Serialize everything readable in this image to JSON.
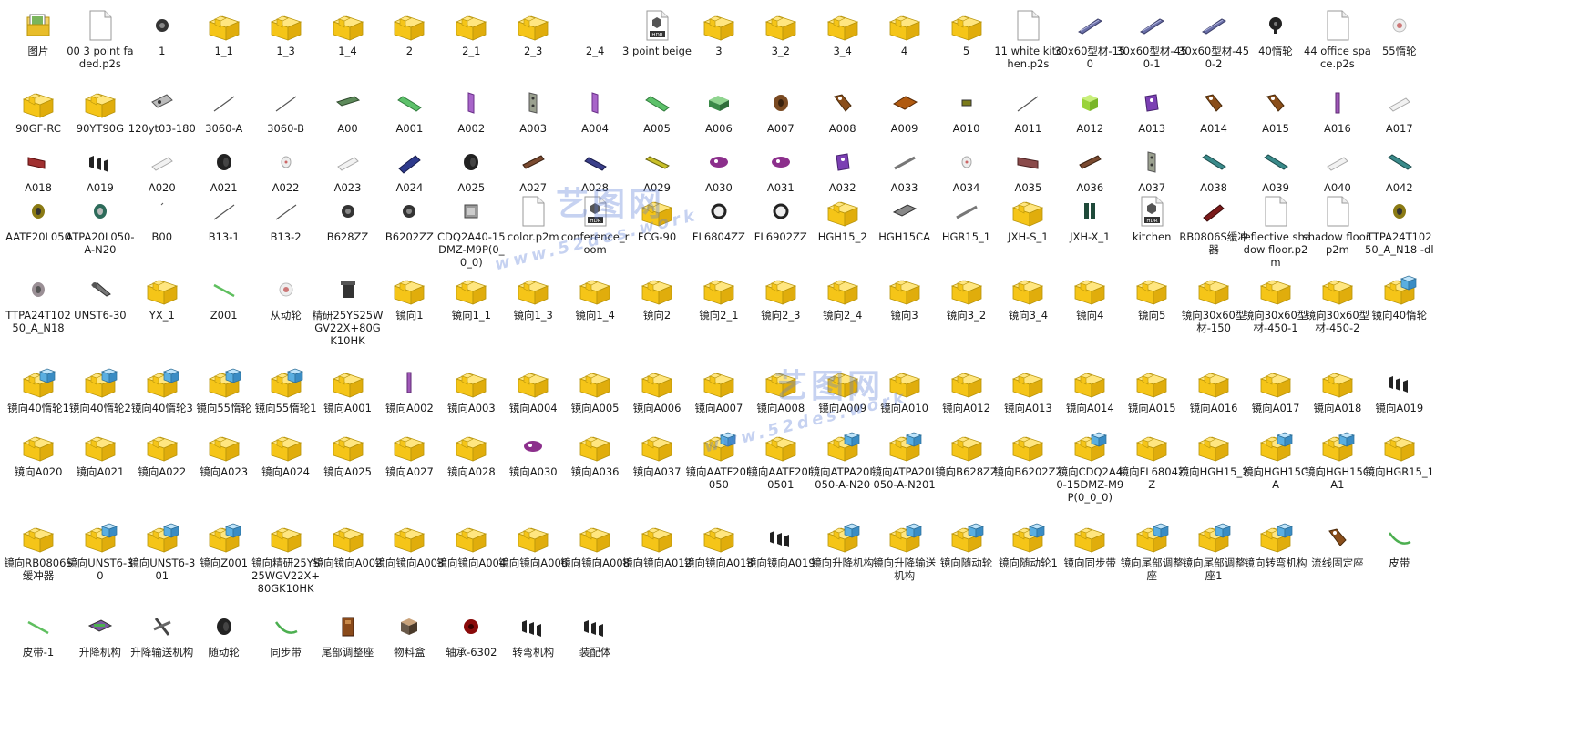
{
  "rows": [
    [
      {
        "label": "图片",
        "icon": "folder-pictures-icon"
      },
      {
        "label": "00 3 point faded.p2s",
        "icon": "document-file-icon"
      },
      {
        "label": "1",
        "icon": "bearing-part-icon"
      },
      {
        "label": "1_1",
        "icon": "assembly-icon"
      },
      {
        "label": "1_3",
        "icon": "assembly-icon"
      },
      {
        "label": "1_4",
        "icon": "assembly-icon"
      },
      {
        "label": "2",
        "icon": "assembly-icon"
      },
      {
        "label": "2_1",
        "icon": "assembly-icon"
      },
      {
        "label": "2_3",
        "icon": "assembly-icon"
      },
      {
        "label": "2_4",
        "icon": "blank-icon"
      },
      {
        "label": "3 point beige",
        "icon": "hdr-file-icon"
      },
      {
        "label": "3",
        "icon": "assembly-icon"
      },
      {
        "label": "3_2",
        "icon": "assembly-icon"
      },
      {
        "label": "3_4",
        "icon": "assembly-icon"
      },
      {
        "label": "4",
        "icon": "assembly-icon"
      },
      {
        "label": "5",
        "icon": "assembly-icon"
      },
      {
        "label": "11 white kitchen.p2s",
        "icon": "document-file-icon"
      },
      {
        "label": "30x60型材-150",
        "icon": "profile-bar-part-icon"
      },
      {
        "label": "30x60型材-450-1",
        "icon": "profile-bar-part-icon"
      },
      {
        "label": "30x60型材-450-2",
        "icon": "profile-bar-part-icon"
      },
      {
        "label": "40惰轮",
        "icon": "idler-wheel-part-icon"
      },
      {
        "label": "44 office space.p2s",
        "icon": "document-file-icon"
      },
      {
        "label": "55惰轮",
        "icon": "pulley-part-icon"
      }
    ],
    [
      {
        "label": "90GF-RC",
        "icon": "assembly-icon"
      },
      {
        "label": "90YT90G",
        "icon": "assembly-icon"
      },
      {
        "label": "120yt03-180",
        "icon": "motor-part-icon"
      },
      {
        "label": "3060-A",
        "icon": "thin-rod-part-icon"
      },
      {
        "label": "3060-B",
        "icon": "thin-rod-part-icon"
      },
      {
        "label": "A00",
        "icon": "plate-part-icon"
      },
      {
        "label": "A001",
        "icon": "green-bar-part-icon"
      },
      {
        "label": "A002",
        "icon": "purple-plate-part-icon"
      },
      {
        "label": "A003",
        "icon": "grey-plate-part-icon"
      },
      {
        "label": "A004",
        "icon": "purple-plate-part-icon"
      },
      {
        "label": "A005",
        "icon": "green-bar-part-icon"
      },
      {
        "label": "A006",
        "icon": "green-block-part-icon"
      },
      {
        "label": "A007",
        "icon": "brown-round-part-icon"
      },
      {
        "label": "A008",
        "icon": "brown-bracket-part-icon"
      },
      {
        "label": "A009",
        "icon": "orange-block-part-icon"
      },
      {
        "label": "A010",
        "icon": "small-block-part-icon"
      },
      {
        "label": "A011",
        "icon": "thin-rod-part-icon"
      },
      {
        "label": "A012",
        "icon": "lime-cube-part-icon"
      },
      {
        "label": "A013",
        "icon": "purple-block-part-icon"
      },
      {
        "label": "A014",
        "icon": "brown-bracket-part-icon"
      },
      {
        "label": "A015",
        "icon": "brown-bracket-part-icon"
      },
      {
        "label": "A016",
        "icon": "purple-bar-part-icon"
      },
      {
        "label": "A017",
        "icon": "white-cylinder-part-icon"
      }
    ],
    [
      {
        "label": "A018",
        "icon": "red-block-part-icon"
      },
      {
        "label": "A019",
        "icon": "black-chain-part-icon"
      },
      {
        "label": "A020",
        "icon": "white-cylinder-part-icon"
      },
      {
        "label": "A021",
        "icon": "black-round-part-icon"
      },
      {
        "label": "A022",
        "icon": "white-small-part-icon"
      },
      {
        "label": "A023",
        "icon": "white-cylinder-part-icon"
      },
      {
        "label": "A024",
        "icon": "blue-cylinder-part-icon"
      },
      {
        "label": "A025",
        "icon": "black-round-part-icon"
      },
      {
        "label": "A027",
        "icon": "brown-bar-part-icon"
      },
      {
        "label": "A028",
        "icon": "navy-bar-part-icon"
      },
      {
        "label": "A029",
        "icon": "yellow-bar-part-icon"
      },
      {
        "label": "A030",
        "icon": "purple-disc-part-icon"
      },
      {
        "label": "A031",
        "icon": "purple-disc-part-icon"
      },
      {
        "label": "A032",
        "icon": "purple-block-part-icon"
      },
      {
        "label": "A033",
        "icon": "grey-bar-part-icon"
      },
      {
        "label": "A034",
        "icon": "white-small-part-icon"
      },
      {
        "label": "A035",
        "icon": "brown-plate-part-icon"
      },
      {
        "label": "A036",
        "icon": "brown-bar-part-icon"
      },
      {
        "label": "A037",
        "icon": "grey-plate-part-icon"
      },
      {
        "label": "A038",
        "icon": "teal-rail-part-icon"
      },
      {
        "label": "A039",
        "icon": "teal-rail-part-icon"
      },
      {
        "label": "A040",
        "icon": "white-cylinder-part-icon"
      },
      {
        "label": "A042",
        "icon": "teal-rail-part-icon"
      }
    ],
    [
      {
        "label": "AATF20L050",
        "icon": "gold-pulley-part-icon"
      },
      {
        "label": "ATPA20L050-A-N20",
        "icon": "teal-pulley-part-icon"
      },
      {
        "label": "B00",
        "icon": "dot-part-icon"
      },
      {
        "label": "B13-1",
        "icon": "thin-rod-part-icon"
      },
      {
        "label": "B13-2",
        "icon": "thin-rod-part-icon"
      },
      {
        "label": "B628ZZ",
        "icon": "bearing-part-icon"
      },
      {
        "label": "B6202ZZ",
        "icon": "bearing-part-icon"
      },
      {
        "label": "CDQ2A40-15DMZ-M9P(0_0_0)",
        "icon": "cylinder-part-icon"
      },
      {
        "label": "color.p2m",
        "icon": "document-file-icon"
      },
      {
        "label": "conference_room",
        "icon": "hdr-file-icon"
      },
      {
        "label": "FCG-90",
        "icon": "assembly-icon"
      },
      {
        "label": "FL6804ZZ",
        "icon": "ring-bearing-part-icon"
      },
      {
        "label": "FL6902ZZ",
        "icon": "ring-bearing-part-icon"
      },
      {
        "label": "HGH15_2",
        "icon": "assembly-icon"
      },
      {
        "label": "HGH15CA",
        "icon": "grey-block-part-icon"
      },
      {
        "label": "HGR15_1",
        "icon": "grey-bar-part-icon"
      },
      {
        "label": "JXH-S_1",
        "icon": "assembly-icon"
      },
      {
        "label": "JXH-X_1",
        "icon": "dark-bracket-part-icon"
      },
      {
        "label": "kitchen",
        "icon": "hdr-file-icon"
      },
      {
        "label": "RB0806S缓冲器",
        "icon": "red-buffer-part-icon"
      },
      {
        "label": "reflective shadow floor.p2m",
        "icon": "document-file-icon"
      },
      {
        "label": "shadow floor.p2m",
        "icon": "document-file-icon"
      },
      {
        "label": "TTPA24T10250_A_N18 -dl",
        "icon": "gold-pulley-part-icon"
      }
    ],
    [
      {
        "label": "TTPA24T10250_A_N18",
        "icon": "grey-pulley-part-icon"
      },
      {
        "label": "UNST6-30",
        "icon": "bolt-part-icon"
      },
      {
        "label": "YX_1",
        "icon": "assembly-icon"
      },
      {
        "label": "Z001",
        "icon": "green-rod-part-icon"
      },
      {
        "label": "从动轮",
        "icon": "pulley-part-icon"
      },
      {
        "label": "精研25YS25WGV22X+80GK10HK",
        "icon": "gear-motor-part-icon"
      },
      {
        "label": "镜向1",
        "icon": "assembly-icon"
      },
      {
        "label": "镜向1_1",
        "icon": "assembly-icon"
      },
      {
        "label": "镜向1_3",
        "icon": "assembly-icon"
      },
      {
        "label": "镜向1_4",
        "icon": "assembly-icon"
      },
      {
        "label": "镜向2",
        "icon": "assembly-icon"
      },
      {
        "label": "镜向2_1",
        "icon": "assembly-icon"
      },
      {
        "label": "镜向2_3",
        "icon": "assembly-icon"
      },
      {
        "label": "镜向2_4",
        "icon": "assembly-icon"
      },
      {
        "label": "镜向3",
        "icon": "assembly-icon"
      },
      {
        "label": "镜向3_2",
        "icon": "assembly-icon"
      },
      {
        "label": "镜向3_4",
        "icon": "assembly-icon"
      },
      {
        "label": "镜向4",
        "icon": "assembly-icon"
      },
      {
        "label": "镜向5",
        "icon": "assembly-icon"
      },
      {
        "label": "镜向30x60型材-150",
        "icon": "assembly-icon"
      },
      {
        "label": "镜向30x60型材-450-1",
        "icon": "assembly-icon"
      },
      {
        "label": "镜向30x60型材-450-2",
        "icon": "assembly-icon"
      },
      {
        "label": "镜向40惰轮",
        "icon": "mirror-assembly-icon"
      }
    ],
    [
      {
        "label": "镜向40惰轮1",
        "icon": "mirror-assembly-icon"
      },
      {
        "label": "镜向40惰轮2",
        "icon": "mirror-assembly-icon"
      },
      {
        "label": "镜向40惰轮3",
        "icon": "mirror-assembly-icon"
      },
      {
        "label": "镜向55惰轮",
        "icon": "mirror-assembly-icon"
      },
      {
        "label": "镜向55惰轮1",
        "icon": "mirror-assembly-icon"
      },
      {
        "label": "镜向A001",
        "icon": "assembly-icon"
      },
      {
        "label": "镜向A002",
        "icon": "purple-bar-part-icon"
      },
      {
        "label": "镜向A003",
        "icon": "assembly-icon"
      },
      {
        "label": "镜向A004",
        "icon": "assembly-icon"
      },
      {
        "label": "镜向A005",
        "icon": "assembly-icon"
      },
      {
        "label": "镜向A006",
        "icon": "assembly-icon"
      },
      {
        "label": "镜向A007",
        "icon": "assembly-icon"
      },
      {
        "label": "镜向A008",
        "icon": "assembly-icon"
      },
      {
        "label": "镜向A009",
        "icon": "assembly-icon"
      },
      {
        "label": "镜向A010",
        "icon": "assembly-icon"
      },
      {
        "label": "镜向A012",
        "icon": "assembly-icon"
      },
      {
        "label": "镜向A013",
        "icon": "assembly-icon"
      },
      {
        "label": "镜向A014",
        "icon": "assembly-icon"
      },
      {
        "label": "镜向A015",
        "icon": "assembly-icon"
      },
      {
        "label": "镜向A016",
        "icon": "assembly-icon"
      },
      {
        "label": "镜向A017",
        "icon": "assembly-icon"
      },
      {
        "label": "镜向A018",
        "icon": "assembly-icon"
      },
      {
        "label": "镜向A019",
        "icon": "black-chain-part-icon"
      }
    ],
    [
      {
        "label": "镜向A020",
        "icon": "assembly-icon"
      },
      {
        "label": "镜向A021",
        "icon": "assembly-icon"
      },
      {
        "label": "镜向A022",
        "icon": "assembly-icon"
      },
      {
        "label": "镜向A023",
        "icon": "assembly-icon"
      },
      {
        "label": "镜向A024",
        "icon": "assembly-icon"
      },
      {
        "label": "镜向A025",
        "icon": "assembly-icon"
      },
      {
        "label": "镜向A027",
        "icon": "assembly-icon"
      },
      {
        "label": "镜向A028",
        "icon": "assembly-icon"
      },
      {
        "label": "镜向A030",
        "icon": "purple-disc-part-icon"
      },
      {
        "label": "镜向A036",
        "icon": "assembly-icon"
      },
      {
        "label": "镜向A037",
        "icon": "assembly-icon"
      },
      {
        "label": "镜向AATF20L050",
        "icon": "mirror-assembly-icon"
      },
      {
        "label": "镜向AATF20L0501",
        "icon": "assembly-icon"
      },
      {
        "label": "镜向ATPA20L050-A-N20",
        "icon": "mirror-assembly-icon"
      },
      {
        "label": "镜向ATPA20L050-A-N201",
        "icon": "mirror-assembly-icon"
      },
      {
        "label": "镜向B628ZZ",
        "icon": "assembly-icon"
      },
      {
        "label": "镜向B6202ZZ",
        "icon": "assembly-icon"
      },
      {
        "label": "镜向CDQ2A40-15DMZ-M9P(0_0_0)",
        "icon": "mirror-assembly-icon"
      },
      {
        "label": "镜向FL6804ZZ",
        "icon": "assembly-icon"
      },
      {
        "label": "镜向HGH15_2",
        "icon": "assembly-icon"
      },
      {
        "label": "镜向HGH15CA",
        "icon": "mirror-assembly-icon"
      },
      {
        "label": "镜向HGH15CA1",
        "icon": "mirror-assembly-icon"
      },
      {
        "label": "镜向HGR15_1",
        "icon": "assembly-icon"
      }
    ],
    [
      {
        "label": "镜向RB0806S缓冲器",
        "icon": "assembly-icon"
      },
      {
        "label": "镜向UNST6-30",
        "icon": "mirror-assembly-icon"
      },
      {
        "label": "镜向UNST6-301",
        "icon": "mirror-assembly-icon"
      },
      {
        "label": "镜向Z001",
        "icon": "mirror-assembly-icon"
      },
      {
        "label": "镜向精研25YS25WGV22X+80GK10HK",
        "icon": "assembly-icon"
      },
      {
        "label": "镜向镜向A002",
        "icon": "assembly-icon"
      },
      {
        "label": "镜向镜向A003",
        "icon": "assembly-icon"
      },
      {
        "label": "镜向镜向A004",
        "icon": "assembly-icon"
      },
      {
        "label": "镜向镜向A006",
        "icon": "assembly-icon"
      },
      {
        "label": "镜向镜向A008",
        "icon": "assembly-icon"
      },
      {
        "label": "镜向镜向A012",
        "icon": "assembly-icon"
      },
      {
        "label": "镜向镜向A013",
        "icon": "assembly-icon"
      },
      {
        "label": "镜向镜向A019",
        "icon": "black-chain-part-icon"
      },
      {
        "label": "镜向升降机构",
        "icon": "mirror-assembly-icon"
      },
      {
        "label": "镜向升降输送机构",
        "icon": "mirror-assembly-icon"
      },
      {
        "label": "镜向随动轮",
        "icon": "mirror-assembly-icon"
      },
      {
        "label": "镜向随动轮1",
        "icon": "mirror-assembly-icon"
      },
      {
        "label": "镜向同步带",
        "icon": "assembly-icon"
      },
      {
        "label": "镜向尾部调整座",
        "icon": "mirror-assembly-icon"
      },
      {
        "label": "镜向尾部调整座1",
        "icon": "mirror-assembly-icon"
      },
      {
        "label": "镜向转弯机构",
        "icon": "mirror-assembly-icon"
      },
      {
        "label": "流线固定座",
        "icon": "brown-bracket-part-icon"
      },
      {
        "label": "皮带",
        "icon": "green-belt-part-icon"
      }
    ],
    [
      {
        "label": "皮带-1",
        "icon": "green-rod-part-icon"
      },
      {
        "label": "升降机构",
        "icon": "mechanism-part-icon"
      },
      {
        "label": "升降输送机构",
        "icon": "frame-part-icon"
      },
      {
        "label": "随动轮",
        "icon": "black-round-part-icon"
      },
      {
        "label": "同步带",
        "icon": "green-belt-part-icon"
      },
      {
        "label": "尾部调整座",
        "icon": "brown-block-part-icon"
      },
      {
        "label": "物料盒",
        "icon": "box-part-icon"
      },
      {
        "label": "轴承-6302",
        "icon": "red-bearing-part-icon"
      },
      {
        "label": "转弯机构",
        "icon": "black-chain-part-icon"
      },
      {
        "label": "装配体",
        "icon": "black-chain-part-icon"
      }
    ]
  ],
  "watermarks": [
    {
      "cn": "艺图网",
      "url": "www.52des.work"
    },
    {
      "cn": "艺图网",
      "url": "www.52des.work"
    }
  ],
  "colors": {
    "folder": "#f5c518",
    "mirror": "#5aaee0",
    "label": "#1a1a1a"
  }
}
